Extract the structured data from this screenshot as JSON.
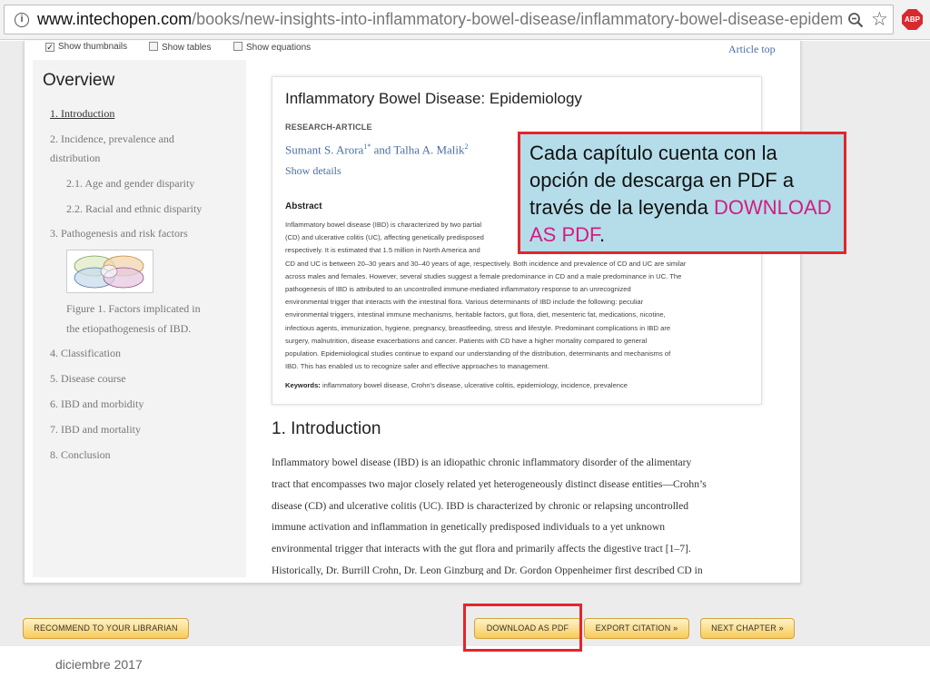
{
  "browser": {
    "url_host": "www.intechopen.com",
    "url_path": "/books/new-insights-into-inflammatory-bowel-disease/inflammatory-bowel-disease-epidemiolo",
    "abp_label": "ABP"
  },
  "toolbar": {
    "show_thumbnails": "Show thumbnails",
    "show_tables": "Show tables",
    "show_equations": "Show equations",
    "article_top": "Article top"
  },
  "sidebar": {
    "title": "Overview",
    "items": [
      {
        "label": "1. Introduction"
      },
      {
        "label": "2. Incidence, prevalence and"
      },
      {
        "label": "distribution"
      },
      {
        "label": "2.1. Age and gender disparity"
      },
      {
        "label": "2.2. Racial and ethnic disparity"
      },
      {
        "label": "3. Pathogenesis and risk factors"
      },
      {
        "label": "Figure 1. Factors implicated in"
      },
      {
        "label": "the etiopathogenesis of IBD."
      },
      {
        "label": "4. Classification"
      },
      {
        "label": "5. Disease course"
      },
      {
        "label": "6. IBD and morbidity"
      },
      {
        "label": "7. IBD and mortality"
      },
      {
        "label": "8. Conclusion"
      }
    ]
  },
  "article": {
    "title": "Inflammatory Bowel Disease: Epidemiology",
    "type": "RESEARCH-ARTICLE",
    "author1": "Sumant S. Arora",
    "author1_sup": "1*",
    "author_join": " and ",
    "author2": "Talha A. Malik",
    "author2_sup": "2",
    "show_details": "Show details",
    "abstract_heading": "Abstract",
    "abstract_lines": [
      "Inflammatory bowel disease (IBD) is characterized by two partial",
      "(CD) and ulcerative colitis (UC), affecting genetically predisposed",
      "respectively. It is estimated that 1.5 million in North America and",
      "CD and UC is between 20–30 years and 30–40 years of age, respectively. Both incidence and prevalence of CD and UC are similar",
      "across males and females. However, several studies suggest a female predominance in CD and a male predominance in UC. The",
      "pathogenesis of IBD is attributed to an uncontrolled immune-mediated inflammatory response to an unrecognized",
      "environmental trigger that interacts with the intestinal flora. Various determinants of IBD include the following: peculiar",
      "environmental triggers, intestinal immune mechanisms, heritable factors, gut flora, diet, mesenteric fat, medications, nicotine,",
      "infectious agents, immunization, hygiene, pregnancy, breastfeeding, stress and lifestyle. Predominant complications in IBD are",
      "surgery, malnutrition, disease exacerbations and cancer. Patients with CD have a higher mortality compared to general",
      "population. Epidemiological studies continue to expand our understanding of the distribution, determinants and mechanisms of",
      "IBD. This has enabled us to recognize safer and effective approaches to management."
    ],
    "keywords_label": "Keywords:",
    "keywords": " inflammatory bowel disease, Crohn's disease, ulcerative colitis, epidemiology, incidence, prevalence",
    "intro_heading": "1. Introduction",
    "intro_lines": [
      "Inflammatory bowel disease (IBD) is an idiopathic chronic inflammatory disorder of the alimentary",
      "tract that encompasses two major closely related yet heterogeneously distinct disease entities—Crohn’s",
      "disease (CD) and ulcerative colitis (UC). IBD is characterized by chronic or relapsing uncontrolled",
      "immune activation and inflammation in genetically predisposed individuals to a yet unknown",
      "environmental trigger that interacts with the gut flora and primarily affects the digestive tract [1–7].",
      "Historically, Dr. Burrill Crohn, Dr. Leon Ginzburg and Dr. Gordon Oppenheimer first described CD in"
    ]
  },
  "callout": {
    "text": "Cada capítulo cuenta con la opción de descarga en PDF a través de la leyenda ",
    "highlight": "DOWNLOAD AS PDF",
    "end": "."
  },
  "buttons": {
    "recommend": "RECOMMEND TO YOUR LIBRARIAN",
    "download_pdf": "DOWNLOAD AS PDF",
    "export_citation": "EXPORT CITATION »",
    "next_chapter": "NEXT CHAPTER »"
  },
  "footer": {
    "date": "diciembre 2017"
  },
  "colors": {
    "link": "#4a6fa5",
    "highlight_border": "#e5242b",
    "callout_bg": "#b4dde9",
    "callout_highlight": "#d51b83",
    "button_gradient_end": "#f7cb5a"
  }
}
